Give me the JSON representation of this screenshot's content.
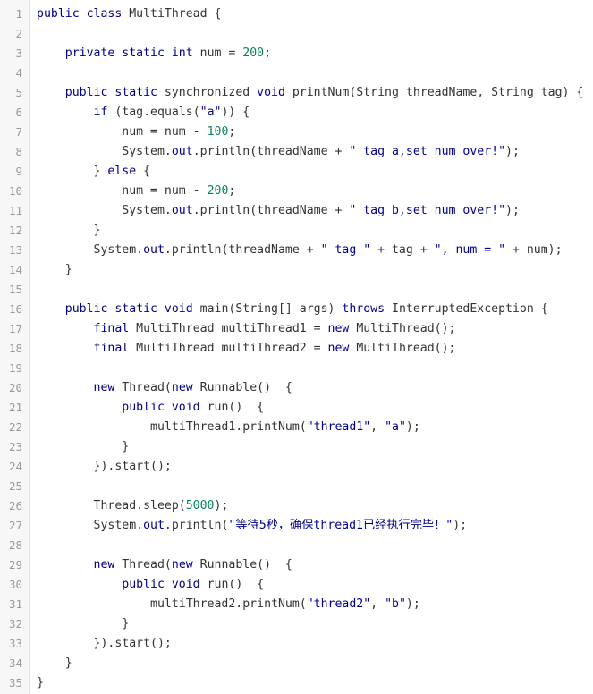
{
  "lines": [
    {
      "n": "1",
      "tokens": [
        {
          "t": "public class",
          "c": "k"
        },
        {
          "t": " MultiThread {",
          "c": "p"
        }
      ]
    },
    {
      "n": "2",
      "tokens": []
    },
    {
      "n": "3",
      "tokens": [
        {
          "t": "    ",
          "c": "p"
        },
        {
          "t": "private static int",
          "c": "k"
        },
        {
          "t": " num = ",
          "c": "p"
        },
        {
          "t": "200",
          "c": "n"
        },
        {
          "t": ";",
          "c": "p"
        }
      ]
    },
    {
      "n": "4",
      "tokens": []
    },
    {
      "n": "5",
      "tokens": [
        {
          "t": "    ",
          "c": "p"
        },
        {
          "t": "public static",
          "c": "k"
        },
        {
          "t": " synchronized ",
          "c": "p"
        },
        {
          "t": "void",
          "c": "k"
        },
        {
          "t": " printNum(String threadName, String tag) {",
          "c": "p"
        }
      ]
    },
    {
      "n": "6",
      "tokens": [
        {
          "t": "        ",
          "c": "p"
        },
        {
          "t": "if",
          "c": "k"
        },
        {
          "t": " (tag.equals(",
          "c": "p"
        },
        {
          "t": "\"a\"",
          "c": "s"
        },
        {
          "t": ")) {",
          "c": "p"
        }
      ]
    },
    {
      "n": "7",
      "tokens": [
        {
          "t": "            num = num - ",
          "c": "p"
        },
        {
          "t": "100",
          "c": "n"
        },
        {
          "t": ";",
          "c": "p"
        }
      ]
    },
    {
      "n": "8",
      "tokens": [
        {
          "t": "            System.",
          "c": "p"
        },
        {
          "t": "out",
          "c": "m"
        },
        {
          "t": ".println(threadName + ",
          "c": "p"
        },
        {
          "t": "\" tag a,set num over!\"",
          "c": "s"
        },
        {
          "t": ");",
          "c": "p"
        }
      ]
    },
    {
      "n": "9",
      "tokens": [
        {
          "t": "        } ",
          "c": "p"
        },
        {
          "t": "else",
          "c": "k"
        },
        {
          "t": " {",
          "c": "p"
        }
      ]
    },
    {
      "n": "10",
      "tokens": [
        {
          "t": "            num = num - ",
          "c": "p"
        },
        {
          "t": "200",
          "c": "n"
        },
        {
          "t": ";",
          "c": "p"
        }
      ]
    },
    {
      "n": "11",
      "tokens": [
        {
          "t": "            System.",
          "c": "p"
        },
        {
          "t": "out",
          "c": "m"
        },
        {
          "t": ".println(threadName + ",
          "c": "p"
        },
        {
          "t": "\" tag b,set num over!\"",
          "c": "s"
        },
        {
          "t": ");",
          "c": "p"
        }
      ]
    },
    {
      "n": "12",
      "tokens": [
        {
          "t": "        }",
          "c": "p"
        }
      ]
    },
    {
      "n": "13",
      "tokens": [
        {
          "t": "        System.",
          "c": "p"
        },
        {
          "t": "out",
          "c": "m"
        },
        {
          "t": ".println(threadName + ",
          "c": "p"
        },
        {
          "t": "\" tag \"",
          "c": "s"
        },
        {
          "t": " + tag + ",
          "c": "p"
        },
        {
          "t": "\", num = \"",
          "c": "s"
        },
        {
          "t": " + num);",
          "c": "p"
        }
      ]
    },
    {
      "n": "14",
      "tokens": [
        {
          "t": "    }",
          "c": "p"
        }
      ]
    },
    {
      "n": "15",
      "tokens": []
    },
    {
      "n": "16",
      "tokens": [
        {
          "t": "    ",
          "c": "p"
        },
        {
          "t": "public static void",
          "c": "k"
        },
        {
          "t": " main(String[] args) ",
          "c": "p"
        },
        {
          "t": "throws",
          "c": "k"
        },
        {
          "t": " InterruptedException {",
          "c": "p"
        }
      ]
    },
    {
      "n": "17",
      "tokens": [
        {
          "t": "        ",
          "c": "p"
        },
        {
          "t": "final",
          "c": "k"
        },
        {
          "t": " MultiThread multiThread1 = ",
          "c": "p"
        },
        {
          "t": "new",
          "c": "k"
        },
        {
          "t": " MultiThread();",
          "c": "p"
        }
      ]
    },
    {
      "n": "18",
      "tokens": [
        {
          "t": "        ",
          "c": "p"
        },
        {
          "t": "final",
          "c": "k"
        },
        {
          "t": " MultiThread multiThread2 = ",
          "c": "p"
        },
        {
          "t": "new",
          "c": "k"
        },
        {
          "t": " MultiThread();",
          "c": "p"
        }
      ]
    },
    {
      "n": "19",
      "tokens": []
    },
    {
      "n": "20",
      "tokens": [
        {
          "t": "        ",
          "c": "p"
        },
        {
          "t": "new",
          "c": "k"
        },
        {
          "t": " Thread(",
          "c": "p"
        },
        {
          "t": "new",
          "c": "k"
        },
        {
          "t": " Runnable()  {",
          "c": "p"
        }
      ]
    },
    {
      "n": "21",
      "tokens": [
        {
          "t": "            ",
          "c": "p"
        },
        {
          "t": "public void",
          "c": "k"
        },
        {
          "t": " run()  {",
          "c": "p"
        }
      ]
    },
    {
      "n": "22",
      "tokens": [
        {
          "t": "                multiThread1.printNum(",
          "c": "p"
        },
        {
          "t": "\"thread1\"",
          "c": "s"
        },
        {
          "t": ", ",
          "c": "p"
        },
        {
          "t": "\"a\"",
          "c": "s"
        },
        {
          "t": ");",
          "c": "p"
        }
      ]
    },
    {
      "n": "23",
      "tokens": [
        {
          "t": "            }",
          "c": "p"
        }
      ]
    },
    {
      "n": "24",
      "tokens": [
        {
          "t": "        }).start();",
          "c": "p"
        }
      ]
    },
    {
      "n": "25",
      "tokens": []
    },
    {
      "n": "26",
      "tokens": [
        {
          "t": "        Thread.sleep(",
          "c": "p"
        },
        {
          "t": "5000",
          "c": "n"
        },
        {
          "t": ");",
          "c": "p"
        }
      ]
    },
    {
      "n": "27",
      "tokens": [
        {
          "t": "        System.",
          "c": "p"
        },
        {
          "t": "out",
          "c": "m"
        },
        {
          "t": ".println(",
          "c": "p"
        },
        {
          "t": "\"等待5秒，确保thread1已经执行完毕！\"",
          "c": "s"
        },
        {
          "t": ");",
          "c": "p"
        }
      ]
    },
    {
      "n": "28",
      "tokens": []
    },
    {
      "n": "29",
      "tokens": [
        {
          "t": "        ",
          "c": "p"
        },
        {
          "t": "new",
          "c": "k"
        },
        {
          "t": " Thread(",
          "c": "p"
        },
        {
          "t": "new",
          "c": "k"
        },
        {
          "t": " Runnable()  {",
          "c": "p"
        }
      ]
    },
    {
      "n": "30",
      "tokens": [
        {
          "t": "            ",
          "c": "p"
        },
        {
          "t": "public void",
          "c": "k"
        },
        {
          "t": " run()  {",
          "c": "p"
        }
      ]
    },
    {
      "n": "31",
      "tokens": [
        {
          "t": "                multiThread2.printNum(",
          "c": "p"
        },
        {
          "t": "\"thread2\"",
          "c": "s"
        },
        {
          "t": ", ",
          "c": "p"
        },
        {
          "t": "\"b\"",
          "c": "s"
        },
        {
          "t": ");",
          "c": "p"
        }
      ]
    },
    {
      "n": "32",
      "tokens": [
        {
          "t": "            }",
          "c": "p"
        }
      ]
    },
    {
      "n": "33",
      "tokens": [
        {
          "t": "        }).start();",
          "c": "p"
        }
      ]
    },
    {
      "n": "34",
      "tokens": [
        {
          "t": "    }",
          "c": "p"
        }
      ]
    },
    {
      "n": "35",
      "tokens": [
        {
          "t": "}",
          "c": "p"
        }
      ]
    }
  ]
}
